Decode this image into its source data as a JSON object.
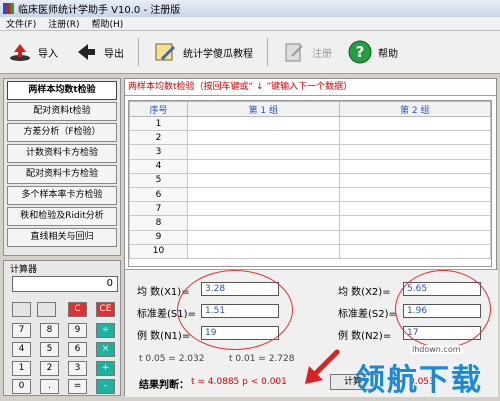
{
  "window": {
    "title": "临床医师统计学助手 V10.0 - 注册版"
  },
  "menu": [
    "文件(F)",
    "注册(R)",
    "帮助(H)"
  ],
  "toolbar": {
    "import": "导入",
    "export": "导出",
    "tutorial": "统计学傻瓜教程",
    "register": "注册",
    "help": "帮助"
  },
  "sidebar": {
    "items": [
      "两样本均数t检验",
      "配对资料t检验",
      "方差分析（F检验）",
      "计数资料卡方检验",
      "配对资料卡方检验",
      "多个样本率卡方检验",
      "秩和检验及Ridit分析",
      "直线相关与回归"
    ]
  },
  "calculator": {
    "title": "计算器",
    "display": "0",
    "keys": {
      "c": "C",
      "ce": "CE",
      "k7": "7",
      "k8": "8",
      "k9": "9",
      "div": "÷",
      "k4": "4",
      "k5": "5",
      "k6": "6",
      "mul": "×",
      "k1": "1",
      "k2": "2",
      "k3": "3",
      "plus": "+",
      "k0": "0",
      "dot": ".",
      "eq": "=",
      "minus": "-"
    }
  },
  "main": {
    "header": "两样本均数t检验（按回车键或“ ↓ ”键输入下一个数据）",
    "columns": [
      "序号",
      "第 1 组",
      "第 2 组"
    ],
    "rows": [
      "1",
      "2",
      "3",
      "4",
      "5",
      "6",
      "7",
      "8",
      "9",
      "10"
    ]
  },
  "results": {
    "g1": {
      "mean_label": "均  数(X1)=",
      "mean": "3.28",
      "sd_label": "标准差(S1)=",
      "sd": "1.51",
      "n_label": "例  数(N1)=",
      "n": "19"
    },
    "g2": {
      "mean_label": "均  数(X2)=",
      "mean": "5.65",
      "sd_label": "标准差(S2)=",
      "sd": "1.96",
      "n_label": "例  数(N2)=",
      "n": "17"
    },
    "t005": "t 0.05 = 2.032",
    "t001": "t 0.01 = 2.728",
    "conclusion_label": "结果判断：",
    "conclusion": "t = 4.0885   p < 0.001",
    "calc_button": "计算",
    "right_result": "p < 0.053"
  },
  "watermark": {
    "text": "领航下载",
    "url": "lhdown.com"
  },
  "colors": {
    "accent_red": "#e00000",
    "accent_blue": "#3050c0",
    "teal": "#20b0a0"
  }
}
